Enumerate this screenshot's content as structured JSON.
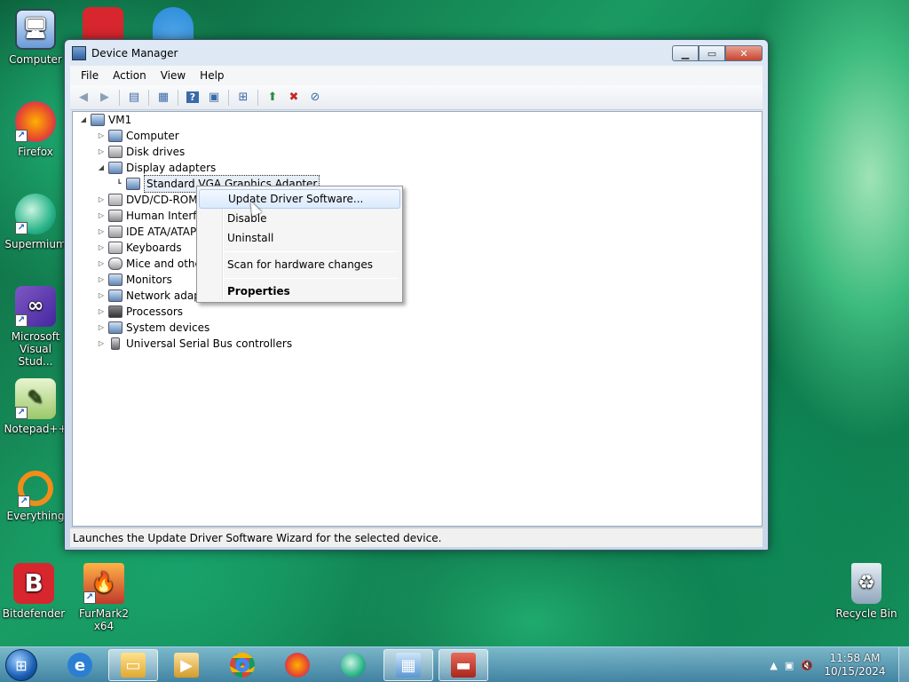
{
  "desktop": {
    "icons": [
      {
        "label": "Computer",
        "icon": "computer-icon"
      },
      {
        "label": "Firefox",
        "icon": "firefox-icon"
      },
      {
        "label": "Supermium",
        "icon": "supermium-icon"
      },
      {
        "label": "Microsoft Visual Stud...",
        "icon": "visual-studio-icon"
      },
      {
        "label": "Notepad++",
        "icon": "notepad-plus-plus-icon"
      },
      {
        "label": "Everything",
        "icon": "everything-icon"
      },
      {
        "label": "Bitdefender",
        "icon": "bitdefender-icon"
      },
      {
        "label": "FurMark2 x64",
        "icon": "furmark-icon"
      },
      {
        "label": "Recycle Bin",
        "icon": "recycle-bin-icon"
      }
    ]
  },
  "window": {
    "title": "Device Manager",
    "menu": [
      "File",
      "Action",
      "View",
      "Help"
    ],
    "status": "Launches the Update Driver Software Wizard for the selected device."
  },
  "tree": {
    "root": "VM1",
    "items": [
      "Computer",
      "Disk drives",
      "Display adapters",
      "Standard VGA Graphics Adapter",
      "DVD/CD-ROM",
      "Human Interfa",
      "IDE ATA/ATAP",
      "Keyboards",
      "Mice and other",
      "Monitors",
      "Network adapt",
      "Processors",
      "System devices",
      "Universal Serial Bus controllers"
    ]
  },
  "context_menu": {
    "items": [
      "Update Driver Software...",
      "Disable",
      "Uninstall",
      "Scan for hardware changes",
      "Properties"
    ]
  },
  "taskbar": {
    "time": "11:58 AM",
    "date": "10/15/2024"
  },
  "colors": {
    "accent": "#1a5fb4",
    "bitdefender": "#d7262e",
    "furmark": "#c0392b",
    "everything": "#f28c1a"
  }
}
